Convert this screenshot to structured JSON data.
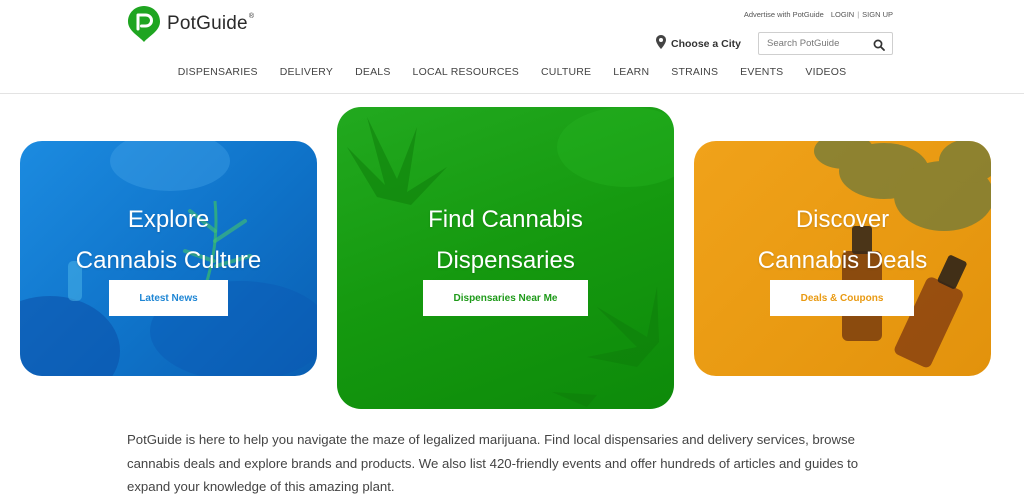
{
  "header": {
    "logo_text": "PotGuide",
    "logo_mark": "®",
    "toplinks": {
      "advertise": "Advertise with PotGuide",
      "login": "LOGIN",
      "separator": "|",
      "signup": "SIGN UP"
    },
    "city_label": "Choose a City",
    "search_placeholder": "Search PotGuide"
  },
  "nav": [
    "DISPENSARIES",
    "DELIVERY",
    "DEALS",
    "LOCAL RESOURCES",
    "CULTURE",
    "LEARN",
    "STRAINS",
    "EVENTS",
    "VIDEOS"
  ],
  "cards": [
    {
      "title_line1": "Explore",
      "title_line2": "Cannabis Culture",
      "button": "Latest News",
      "color": "#1a86dc"
    },
    {
      "title_line1": "Find Cannabis",
      "title_line2": "Dispensaries",
      "button": "Dispensaries Near Me",
      "color": "#1aa316"
    },
    {
      "title_line1": "Discover",
      "title_line2": "Cannabis Deals",
      "button": "Deals & Coupons",
      "color": "#eda016"
    }
  ],
  "intro_text": "PotGuide is here to help you navigate the maze of legalized marijuana. Find local dispensaries and delivery services, browse cannabis deals and explore brands and products. We also list 420-friendly events and offer hundreds of articles and guides to expand your knowledge of this amazing plant.",
  "colors": {
    "brand_green": "#1fa521",
    "text": "#444444"
  },
  "icons": {
    "logo": "map-pin-leaf-logo-icon",
    "city": "location-pin-icon",
    "search": "search-icon"
  }
}
